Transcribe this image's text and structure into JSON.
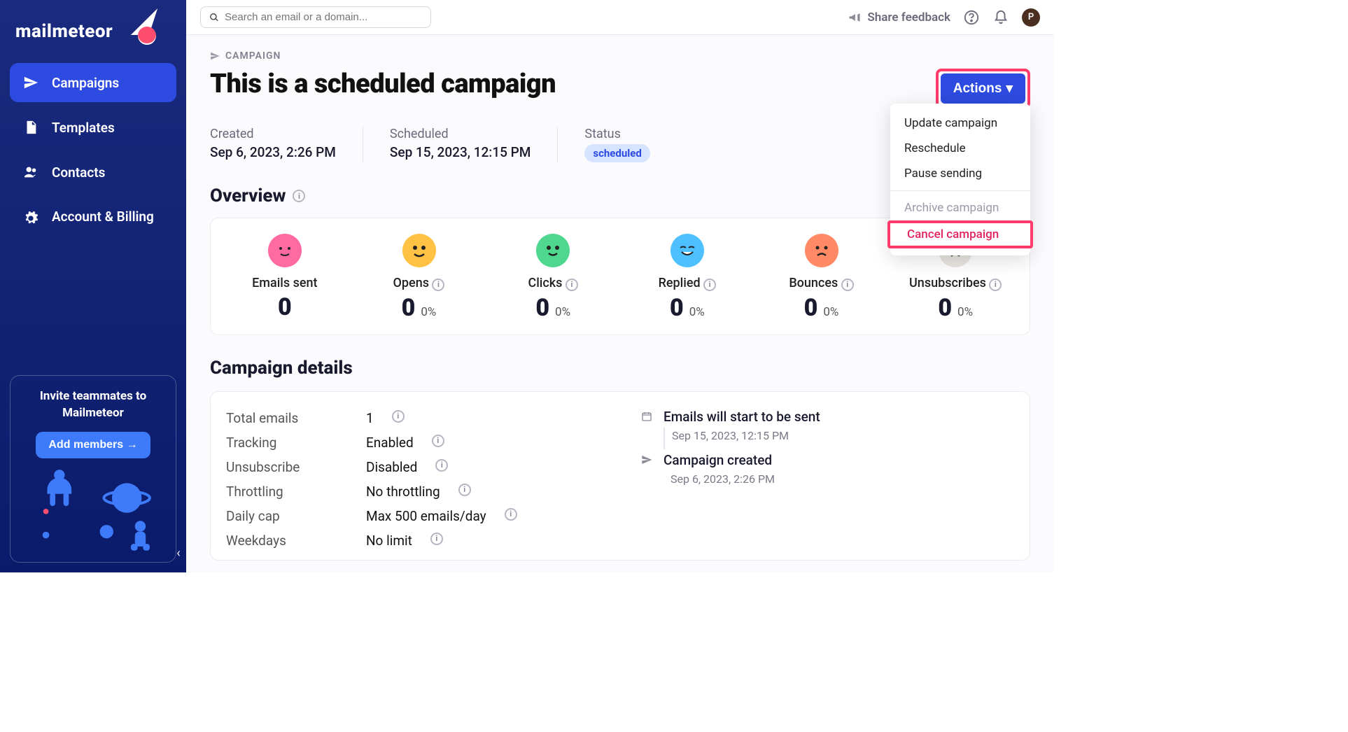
{
  "brand": "mailmeteor",
  "sidebar": {
    "items": [
      {
        "label": "Campaigns",
        "active": true
      },
      {
        "label": "Templates",
        "active": false
      },
      {
        "label": "Contacts",
        "active": false
      },
      {
        "label": "Account & Billing",
        "active": false
      }
    ],
    "invite": {
      "title": "Invite teammates to Mailmeteor",
      "button": "Add members →"
    }
  },
  "search": {
    "placeholder": "Search an email or a domain..."
  },
  "topbar": {
    "share_feedback": "Share feedback",
    "avatar_letter": "P"
  },
  "breadcrumb": "CAMPAIGN",
  "campaign": {
    "title": "This is a scheduled campaign",
    "created_label": "Created",
    "created_value": "Sep 6, 2023, 2:26 PM",
    "scheduled_label": "Scheduled",
    "scheduled_value": "Sep 15, 2023, 12:15 PM",
    "status_label": "Status",
    "status_value": "scheduled"
  },
  "actions": {
    "button": "Actions",
    "menu": {
      "update": "Update campaign",
      "reschedule": "Reschedule",
      "pause": "Pause sending",
      "archive": "Archive campaign",
      "cancel": "Cancel campaign"
    }
  },
  "overview": {
    "title": "Overview",
    "stats": [
      {
        "label": "Emails sent",
        "value": "0",
        "pct": ""
      },
      {
        "label": "Opens",
        "value": "0",
        "pct": "0%"
      },
      {
        "label": "Clicks",
        "value": "0",
        "pct": "0%"
      },
      {
        "label": "Replied",
        "value": "0",
        "pct": "0%"
      },
      {
        "label": "Bounces",
        "value": "0",
        "pct": "0%"
      },
      {
        "label": "Unsubscribes",
        "value": "0",
        "pct": "0%"
      }
    ]
  },
  "details": {
    "title": "Campaign details",
    "rows": [
      {
        "label": "Total emails",
        "value": "1"
      },
      {
        "label": "Tracking",
        "value": "Enabled"
      },
      {
        "label": "Unsubscribe",
        "value": "Disabled"
      },
      {
        "label": "Throttling",
        "value": "No throttling"
      },
      {
        "label": "Daily cap",
        "value": "Max 500 emails/day"
      },
      {
        "label": "Weekdays",
        "value": "No limit"
      }
    ],
    "timeline": [
      {
        "title": "Emails will start to be sent",
        "sub": "Sep 15, 2023, 12:15 PM"
      },
      {
        "title": "Campaign created",
        "sub": "Sep 6, 2023, 2:26 PM"
      }
    ]
  }
}
